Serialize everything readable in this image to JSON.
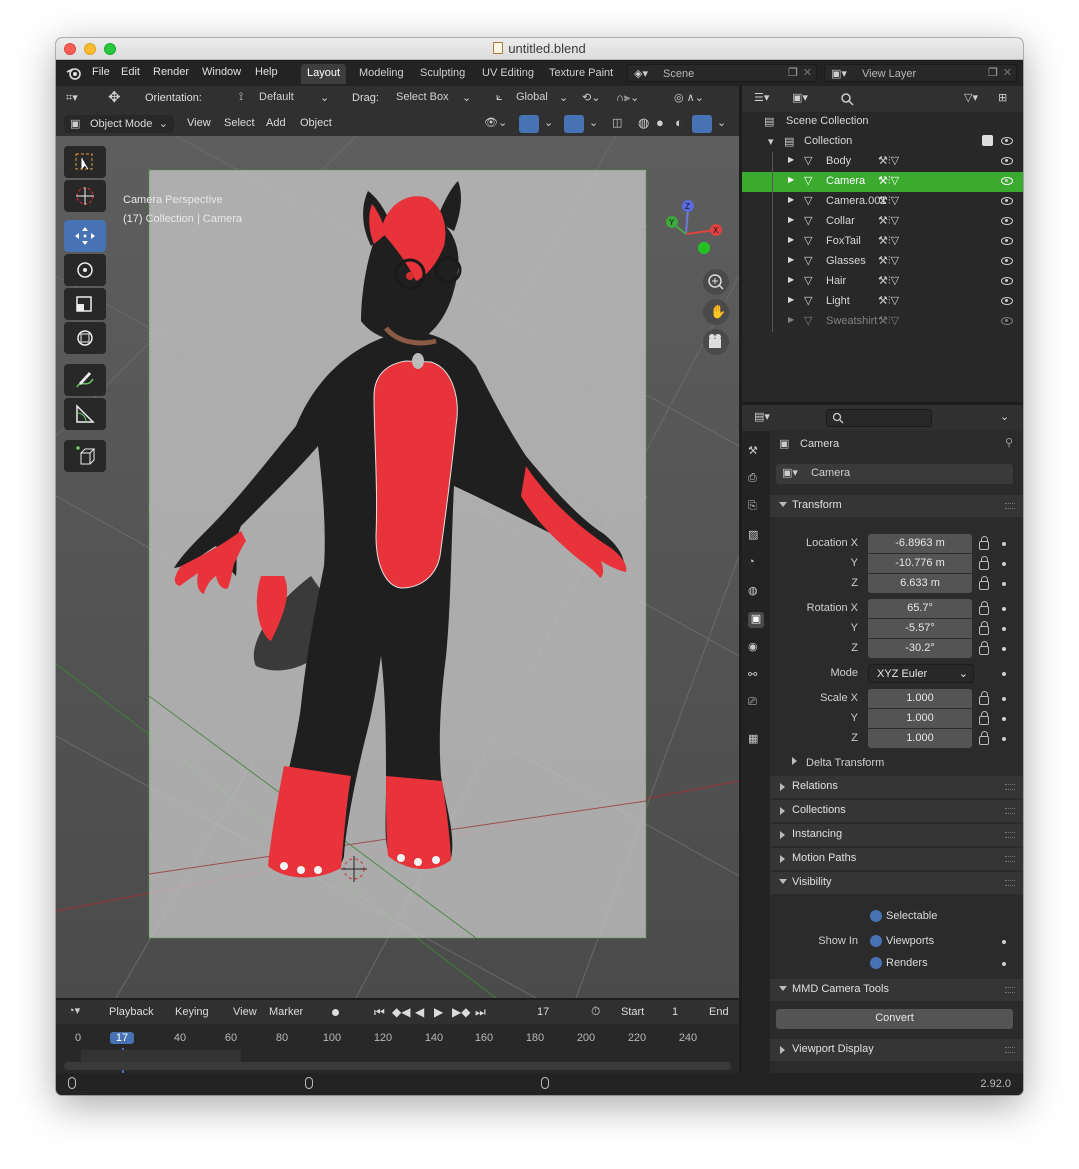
{
  "window": {
    "title": "untitled.blend"
  },
  "menu": [
    "File",
    "Edit",
    "Render",
    "Window",
    "Help"
  ],
  "workspaces": [
    "Layout",
    "Modeling",
    "Sculpting",
    "UV Editing",
    "Texture Paint"
  ],
  "active_workspace": "Layout",
  "scene": {
    "name": "Scene"
  },
  "view_layer": {
    "name": "View Layer"
  },
  "viewport": {
    "orientation_label": "Orientation:",
    "orientation_value": "Default",
    "drag_label": "Drag:",
    "drag_value": "Select Box",
    "transform_space": "Global",
    "mode": "Object Mode",
    "menus": [
      "View",
      "Select",
      "Add",
      "Object"
    ],
    "overlay_title": "Camera Perspective",
    "overlay_subtitle": "(17) Collection | Camera"
  },
  "outliner": {
    "scene_collection": "Scene Collection",
    "collection": "Collection",
    "items": [
      {
        "name": "Body",
        "selected": false,
        "dimmed": false
      },
      {
        "name": "Camera",
        "selected": true,
        "dimmed": false
      },
      {
        "name": "Camera.001",
        "selected": false,
        "dimmed": false
      },
      {
        "name": "Collar",
        "selected": false,
        "dimmed": false
      },
      {
        "name": "FoxTail",
        "selected": false,
        "dimmed": false
      },
      {
        "name": "Glasses",
        "selected": false,
        "dimmed": false
      },
      {
        "name": "Hair",
        "selected": false,
        "dimmed": false
      },
      {
        "name": "Light",
        "selected": false,
        "dimmed": false
      },
      {
        "name": "Sweatshirt",
        "selected": false,
        "dimmed": true
      }
    ]
  },
  "properties": {
    "object_name": "Camera",
    "data_name": "Camera",
    "transform": {
      "title": "Transform",
      "location_x_label": "Location X",
      "location_x": "-6.8963 m",
      "location_y_label": "Y",
      "location_y": "-10.776 m",
      "location_z_label": "Z",
      "location_z": "6.633 m",
      "rotation_x_label": "Rotation X",
      "rotation_x": "65.7°",
      "rotation_y_label": "Y",
      "rotation_y": "-5.57°",
      "rotation_z_label": "Z",
      "rotation_z": "-30.2°",
      "mode_label": "Mode",
      "mode": "XYZ Euler",
      "scale_x_label": "Scale X",
      "scale_x": "1.000",
      "scale_y_label": "Y",
      "scale_y": "1.000",
      "scale_z_label": "Z",
      "scale_z": "1.000",
      "delta": "Delta Transform"
    },
    "panels": [
      "Relations",
      "Collections",
      "Instancing",
      "Motion Paths"
    ],
    "visibility": {
      "title": "Visibility",
      "selectable": "Selectable",
      "show_in": "Show In",
      "viewports": "Viewports",
      "renders": "Renders"
    },
    "mmd": {
      "title": "MMD Camera Tools",
      "convert": "Convert"
    },
    "viewport_display": "Viewport Display"
  },
  "timeline": {
    "menus": [
      "Playback",
      "Keying",
      "View",
      "Marker"
    ],
    "current_frame": "17",
    "start_label": "Start",
    "start": "1",
    "end_label": "End",
    "ruler": [
      "0",
      "17",
      "40",
      "60",
      "80",
      "100",
      "120",
      "140",
      "160",
      "180",
      "200",
      "220",
      "240"
    ]
  },
  "status": {
    "version": "2.92.0"
  },
  "colors": {
    "accent": "#4772b3",
    "selected_row": "#3bab2f",
    "fur_red": "#e8333b",
    "fur_black": "#1f1f1f"
  }
}
